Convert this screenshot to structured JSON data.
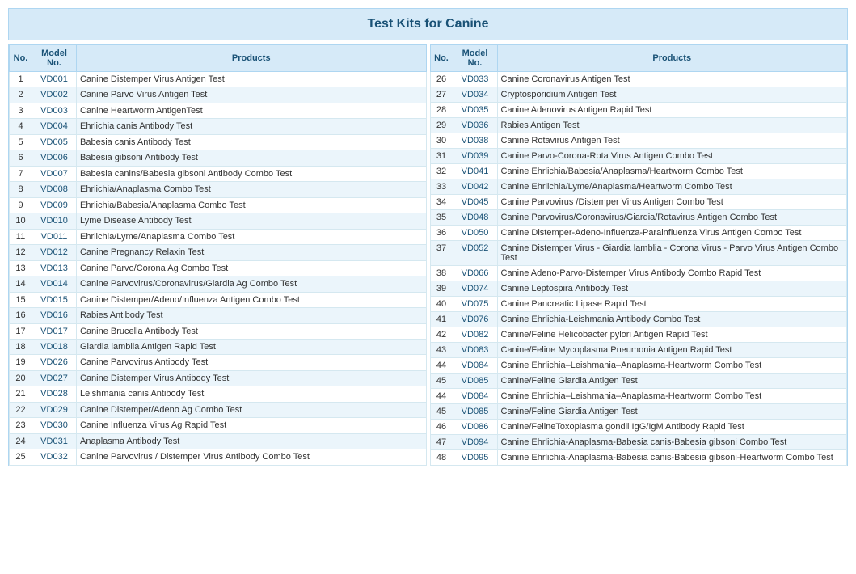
{
  "title": "Test Kits for Canine",
  "headers": {
    "no": "No.",
    "model": "Model No.",
    "products": "Products"
  },
  "left_rows": [
    {
      "no": 1,
      "model": "VD001",
      "product": "Canine Distemper Virus Antigen Test"
    },
    {
      "no": 2,
      "model": "VD002",
      "product": "Canine Parvo Virus Antigen Test"
    },
    {
      "no": 3,
      "model": "VD003",
      "product": "Canine Heartworm AntigenTest"
    },
    {
      "no": 4,
      "model": "VD004",
      "product": "Ehrlichia canis Antibody Test"
    },
    {
      "no": 5,
      "model": "VD005",
      "product": "Babesia canis Antibody Test"
    },
    {
      "no": 6,
      "model": "VD006",
      "product": "Babesia gibsoni Antibody Test"
    },
    {
      "no": 7,
      "model": "VD007",
      "product": "Babesia canins/Babesia gibsoni Antibody Combo Test"
    },
    {
      "no": 8,
      "model": "VD008",
      "product": "Ehrlichia/Anaplasma Combo Test"
    },
    {
      "no": 9,
      "model": "VD009",
      "product": "Ehrlichia/Babesia/Anaplasma Combo Test"
    },
    {
      "no": 10,
      "model": "VD010",
      "product": "Lyme Disease Antibody Test"
    },
    {
      "no": 11,
      "model": "VD011",
      "product": "Ehrlichia/Lyme/Anaplasma Combo Test"
    },
    {
      "no": 12,
      "model": "VD012",
      "product": "Canine Pregnancy Relaxin Test"
    },
    {
      "no": 13,
      "model": "VD013",
      "product": "Canine Parvo/Corona Ag Combo Test"
    },
    {
      "no": 14,
      "model": "VD014",
      "product": "Canine Parvovirus/Coronavirus/Giardia Ag Combo Test"
    },
    {
      "no": 15,
      "model": "VD015",
      "product": "Canine Distemper/Adeno/Influenza Antigen Combo Test"
    },
    {
      "no": 16,
      "model": "VD016",
      "product": "Rabies Antibody Test"
    },
    {
      "no": 17,
      "model": "VD017",
      "product": "Canine Brucella Antibody Test"
    },
    {
      "no": 18,
      "model": "VD018",
      "product": "Giardia lamblia Antigen Rapid Test"
    },
    {
      "no": 19,
      "model": "VD026",
      "product": "Canine Parvovirus Antibody Test"
    },
    {
      "no": 20,
      "model": "VD027",
      "product": "Canine Distemper Virus Antibody Test"
    },
    {
      "no": 21,
      "model": "VD028",
      "product": "Leishmania canis Antibody Test"
    },
    {
      "no": 22,
      "model": "VD029",
      "product": "Canine Distemper/Adeno Ag Combo Test"
    },
    {
      "no": 23,
      "model": "VD030",
      "product": "Canine Influenza Virus Ag Rapid Test"
    },
    {
      "no": 24,
      "model": "VD031",
      "product": "Anaplasma Antibody Test"
    },
    {
      "no": 25,
      "model": "VD032",
      "product": "Canine Parvovirus / Distemper Virus Antibody Combo Test"
    }
  ],
  "right_rows": [
    {
      "no": 26,
      "model": "VD033",
      "product": "Canine Coronavirus Antigen Test"
    },
    {
      "no": 27,
      "model": "VD034",
      "product": "Cryptosporidium Antigen Test"
    },
    {
      "no": 28,
      "model": "VD035",
      "product": "Canine Adenovirus Antigen Rapid Test"
    },
    {
      "no": 29,
      "model": "VD036",
      "product": "Rabies Antigen Test"
    },
    {
      "no": 30,
      "model": "VD038",
      "product": "Canine Rotavirus Antigen Test"
    },
    {
      "no": 31,
      "model": "VD039",
      "product": "Canine Parvo-Corona-Rota Virus Antigen Combo Test"
    },
    {
      "no": 32,
      "model": "VD041",
      "product": "Canine Ehrlichia/Babesia/Anaplasma/Heartworm Combo Test"
    },
    {
      "no": 33,
      "model": "VD042",
      "product": "Canine Ehrlichia/Lyme/Anaplasma/Heartworm Combo Test"
    },
    {
      "no": 34,
      "model": "VD045",
      "product": "Canine Parvovirus /Distemper Virus Antigen Combo Test"
    },
    {
      "no": 35,
      "model": "VD048",
      "product": "Canine Parvovirus/Coronavirus/Giardia/Rotavirus Antigen Combo Test"
    },
    {
      "no": 36,
      "model": "VD050",
      "product": "Canine Distemper-Adeno-Influenza-Parainfluenza Virus Antigen Combo Test"
    },
    {
      "no": 37,
      "model": "VD052",
      "product": "Canine Distemper Virus - Giardia lamblia - Corona Virus - Parvo Virus Antigen Combo Test"
    },
    {
      "no": 38,
      "model": "VD066",
      "product": "Canine Adeno-Parvo-Distemper Virus Antibody Combo Rapid Test"
    },
    {
      "no": 39,
      "model": "VD074",
      "product": "Canine Leptospira Antibody Test"
    },
    {
      "no": 40,
      "model": "VD075",
      "product": "Canine Pancreatic Lipase Rapid Test"
    },
    {
      "no": 41,
      "model": "VD076",
      "product": "Canine Ehrlichia-Leishmania Antibody Combo Test"
    },
    {
      "no": 42,
      "model": "VD082",
      "product": "Canine/Feline Helicobacter pylori Antigen Rapid Test"
    },
    {
      "no": 43,
      "model": "VD083",
      "product": "Canine/Feline  Mycoplasma Pneumonia Antigen Rapid Test"
    },
    {
      "no": 44,
      "model": "VD084",
      "product": "Canine Ehrlichia–Leishmania–Anaplasma-Heartworm Combo Test"
    },
    {
      "no": 45,
      "model": "VD085",
      "product": "Canine/Feline  Giardia Antigen Test"
    },
    {
      "no": "44",
      "model": "VD084",
      "product": "Canine Ehrlichia–Leishmania–Anaplasma-Heartworm Combo Test"
    },
    {
      "no": "45",
      "model": "VD085",
      "product": "Canine/Feline  Giardia Antigen Test"
    },
    {
      "no": 46,
      "model": "VD086",
      "product": "Canine/FelineToxoplasma gondii IgG/IgM Antibody Rapid Test"
    },
    {
      "no": 47,
      "model": "VD094",
      "product": "Canine Ehrlichia-Anaplasma-Babesia canis-Babesia gibsoni Combo Test"
    },
    {
      "no": 48,
      "model": "VD095",
      "product": "Canine Ehrlichia-Anaplasma-Babesia canis-Babesia gibsoni-Heartworm Combo Test"
    }
  ]
}
